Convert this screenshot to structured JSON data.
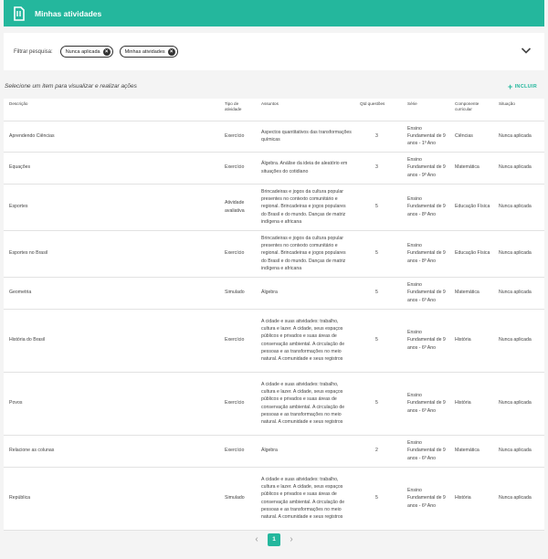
{
  "header": {
    "title": "Minhas atividades",
    "logo_icon": "document-logo-icon"
  },
  "filter": {
    "label": "Filtrar pesquisa:",
    "chips": [
      {
        "label": "Nunca aplicada"
      },
      {
        "label": "Minhas atividades"
      }
    ]
  },
  "hint": "Selecione um item para visualizar e realizar ações",
  "include_label": "INCLUIR",
  "table": {
    "headers": {
      "descricao": "Descrição",
      "tipo": "Tipo de atividade",
      "assuntos": "Assuntos",
      "qtd": "Qtd questões",
      "serie": "Série",
      "componente": "Componente curricular",
      "situacao": "Situação"
    },
    "rows": [
      {
        "descricao": "Aprendendo Ciências",
        "tipo": "Exercício",
        "assuntos": "Aspectos quantitativos das transformações químicas",
        "qtd": "3",
        "serie": "Ensino Fundamental de 9 anos - 1º Ano",
        "componente": "Ciências",
        "situacao": "Nunca aplicada"
      },
      {
        "descricao": "Equações",
        "tipo": "Exercício",
        "assuntos": "Álgebra. Análise da ideia de aleatório em situações do cotidiano",
        "qtd": "3",
        "serie": "Ensino Fundamental de 9 anos - 9º Ano",
        "componente": "Matemática",
        "situacao": "Nunca aplicada"
      },
      {
        "descricao": "Esportes",
        "tipo": "Atividade avaliativa",
        "assuntos": "Brincadeiras e jogos da cultura popular presentes no contexto comunitário e regional. Brincadeiras e jogos populares do Brasil e do mundo. Danças de matriz indígena e africana",
        "qtd": "5",
        "serie": "Ensino Fundamental de 9 anos - 8º Ano",
        "componente": "Educação Física",
        "situacao": "Nunca aplicada"
      },
      {
        "descricao": "Esportes no Brasil",
        "tipo": "Exercício",
        "assuntos": "Brincadeiras e jogos da cultura popular presentes no contexto comunitário e regional. Brincadeiras e jogos populares do Brasil e do mundo. Danças de matriz indígena e africana",
        "qtd": "5",
        "serie": "Ensino Fundamental de 9 anos - 8º Ano",
        "componente": "Educação Física",
        "situacao": "Nunca aplicada"
      },
      {
        "descricao": "Geometria",
        "tipo": "Simulado",
        "assuntos": "Álgebra",
        "qtd": "5",
        "serie": "Ensino Fundamental de 9 anos - 6º Ano",
        "componente": "Matemática",
        "situacao": "Nunca aplicada"
      },
      {
        "descricao": "História do Brasil",
        "tipo": "Exercício",
        "assuntos": "A cidade e suas atividades: trabalho, cultura e lazer. A cidade, seus espaços públicos e privados e suas áreas de conservação ambiental. A circulação de pessoas e as transformações no meio natural. A comunidade e seus registros",
        "qtd": "5",
        "serie": "Ensino Fundamental de 9 anos - 6º Ano",
        "componente": "História",
        "situacao": "Nunca aplicada"
      },
      {
        "descricao": "Povos",
        "tipo": "Exercício",
        "assuntos": "A cidade e suas atividades: trabalho, cultura e lazer. A cidade, seus espaços públicos e privados e suas áreas de conservação ambiental. A circulação de pessoas e as transformações no meio natural. A comunidade e seus registros",
        "qtd": "5",
        "serie": "Ensino Fundamental de 9 anos - 6º Ano",
        "componente": "História",
        "situacao": "Nunca aplicada"
      },
      {
        "descricao": "Relacione as colunas",
        "tipo": "Exercício",
        "assuntos": "Álgebra",
        "qtd": "2",
        "serie": "Ensino Fundamental de 9 anos - 6º Ano",
        "componente": "Matemática",
        "situacao": "Nunca aplicada"
      },
      {
        "descricao": "República",
        "tipo": "Simulado",
        "assuntos": "A cidade e suas atividades: trabalho, cultura e lazer. A cidade, seus espaços públicos e privados e suas áreas de conservação ambiental. A circulação de pessoas e as transformações no meio natural. A comunidade e seus registros",
        "qtd": "5",
        "serie": "Ensino Fundamental de 9 anos - 6º Ano",
        "componente": "História",
        "situacao": "Nunca aplicada"
      }
    ]
  },
  "pagination": {
    "current_page": "1"
  },
  "colors": {
    "accent": "#24b79d",
    "chip_border": "#333333",
    "text": "#444444"
  }
}
